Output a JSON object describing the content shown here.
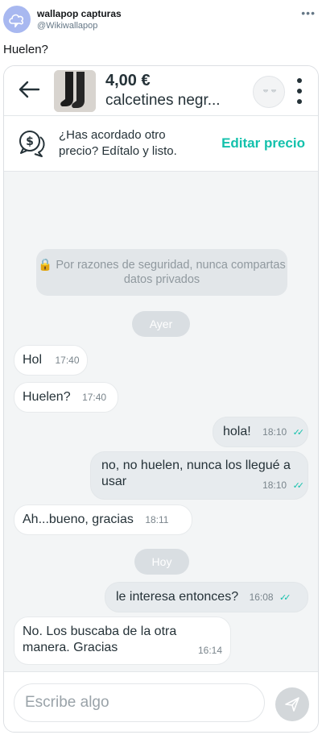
{
  "tweet": {
    "author": "wallapop capturas",
    "handle": "@Wikiwallapop",
    "text": "Huelen?",
    "more": "•••"
  },
  "product": {
    "price": "4,00 €",
    "title": "calcetines negr..."
  },
  "offer": {
    "text": "¿Has acordado otro precio? Edítalo y listo.",
    "action_label": "Editar precio"
  },
  "chat": {
    "security_notice": "🔒 Por razones de seguridad, nunca compartas datos privados",
    "day_ayer": "Ayer",
    "day_hoy": "Hoy",
    "messages": [
      {
        "text": "Hol",
        "time": "17:40"
      },
      {
        "text": "Huelen?",
        "time": "17:40"
      },
      {
        "text": "hola!",
        "time": "18:10"
      },
      {
        "text": "no, no huelen, nunca los llegué a usar",
        "time": "18:10"
      },
      {
        "text": "Ah...bueno, gracias",
        "time": "18:11"
      },
      {
        "text": "le interesa entonces?",
        "time": "16:08"
      },
      {
        "text": "No. Los buscaba de la otra manera. Gracias",
        "time": "16:14"
      }
    ]
  },
  "composer": {
    "placeholder": "Escribe algo"
  },
  "colors": {
    "accent": "#13c1ac",
    "outgoing_bubble": "#e7ebee",
    "chat_bg": "#f3f5f6"
  }
}
